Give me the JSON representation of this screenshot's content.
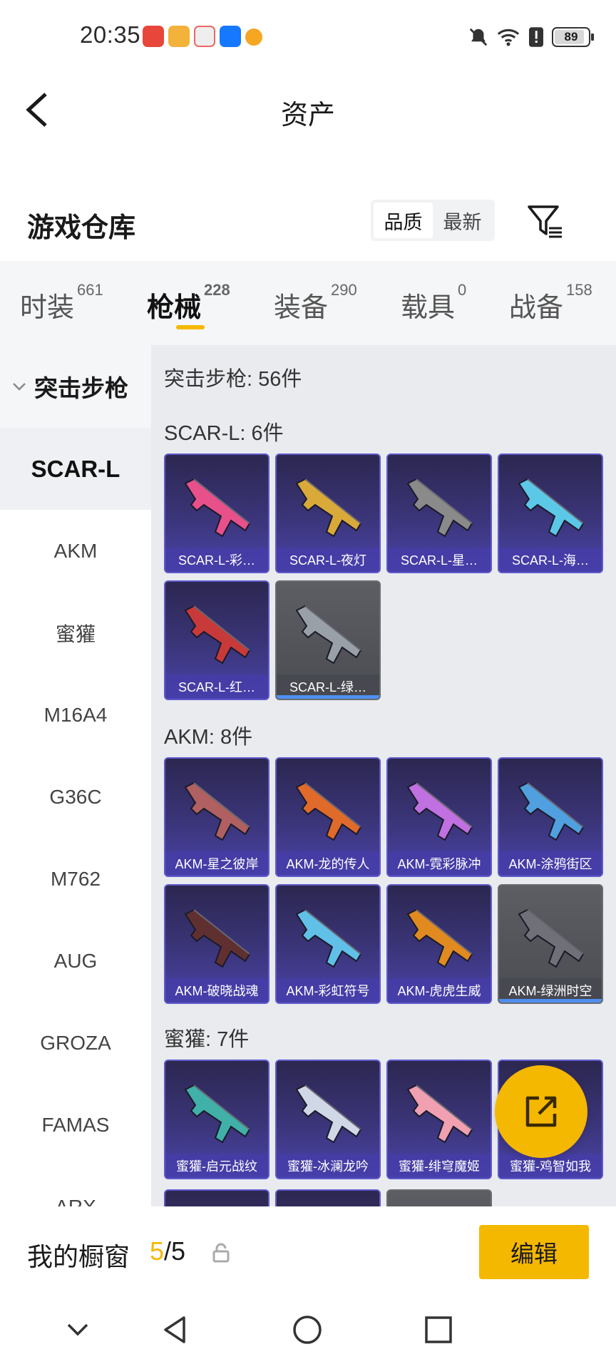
{
  "status_bar": {
    "time": "20:35",
    "battery": "89",
    "battery_level": 0.89,
    "app_icons": [
      "huawei-app-icon",
      "circle-app-icon",
      "gift-app-icon",
      "alipay-icon",
      "cat-app-icon"
    ],
    "right_icons": [
      "mute-bell-icon",
      "wifi-icon",
      "alert-icon",
      "battery-icon"
    ]
  },
  "header": {
    "title": "资产"
  },
  "warehouse": {
    "title": "游戏仓库",
    "sort_options": [
      "品质",
      "最新"
    ],
    "sort_selected": "品质"
  },
  "tabs": [
    {
      "label": "时装",
      "count": "661"
    },
    {
      "label": "枪械",
      "count": "228",
      "active": true
    },
    {
      "label": "装备",
      "count": "290"
    },
    {
      "label": "载具",
      "count": "0"
    },
    {
      "label": "战备",
      "count": "158"
    }
  ],
  "sidebar": {
    "group": "突击步枪",
    "items": [
      "SCAR-L",
      "AKM",
      "蜜獾",
      "M16A4",
      "G36C",
      "M762",
      "AUG",
      "GROZA",
      "FAMAS",
      "ARX"
    ],
    "active": "SCAR-L"
  },
  "content": {
    "total": "突击步枪: 56件",
    "sections": [
      {
        "title": "SCAR-L: 6件",
        "items": [
          "SCAR-L-彩…",
          "SCAR-L-夜灯",
          "SCAR-L-星…",
          "SCAR-L-海…",
          "SCAR-L-红…",
          "SCAR-L-绿…"
        ]
      },
      {
        "title": "AKM: 8件",
        "items": [
          "AKM-星之彼岸",
          "AKM-龙的传人",
          "AKM-霓彩脉冲",
          "AKM-涂鸦街区",
          "AKM-破晓战魂",
          "AKM-彩虹符号",
          "AKM-虎虎生威",
          "AKM-绿洲时空"
        ]
      },
      {
        "title": "蜜獾: 7件",
        "items": [
          "蜜獾-启元战纹",
          "蜜獾-冰澜龙吟",
          "蜜獾-绯穹魔姬",
          "蜜獾-鸡智如我"
        ]
      }
    ],
    "colors": {
      "card_purple": "#3b357a",
      "card_grey": "#4a4c52",
      "accent": "#f5b800"
    }
  },
  "showcase": {
    "label": "我的橱窗",
    "count_current": "5",
    "count_sep": "/",
    "count_total": "5",
    "edit_label": "编辑"
  },
  "nav_bar": [
    "chevron-down-icon",
    "back-triangle-icon",
    "home-circle-icon",
    "recents-square-icon"
  ]
}
